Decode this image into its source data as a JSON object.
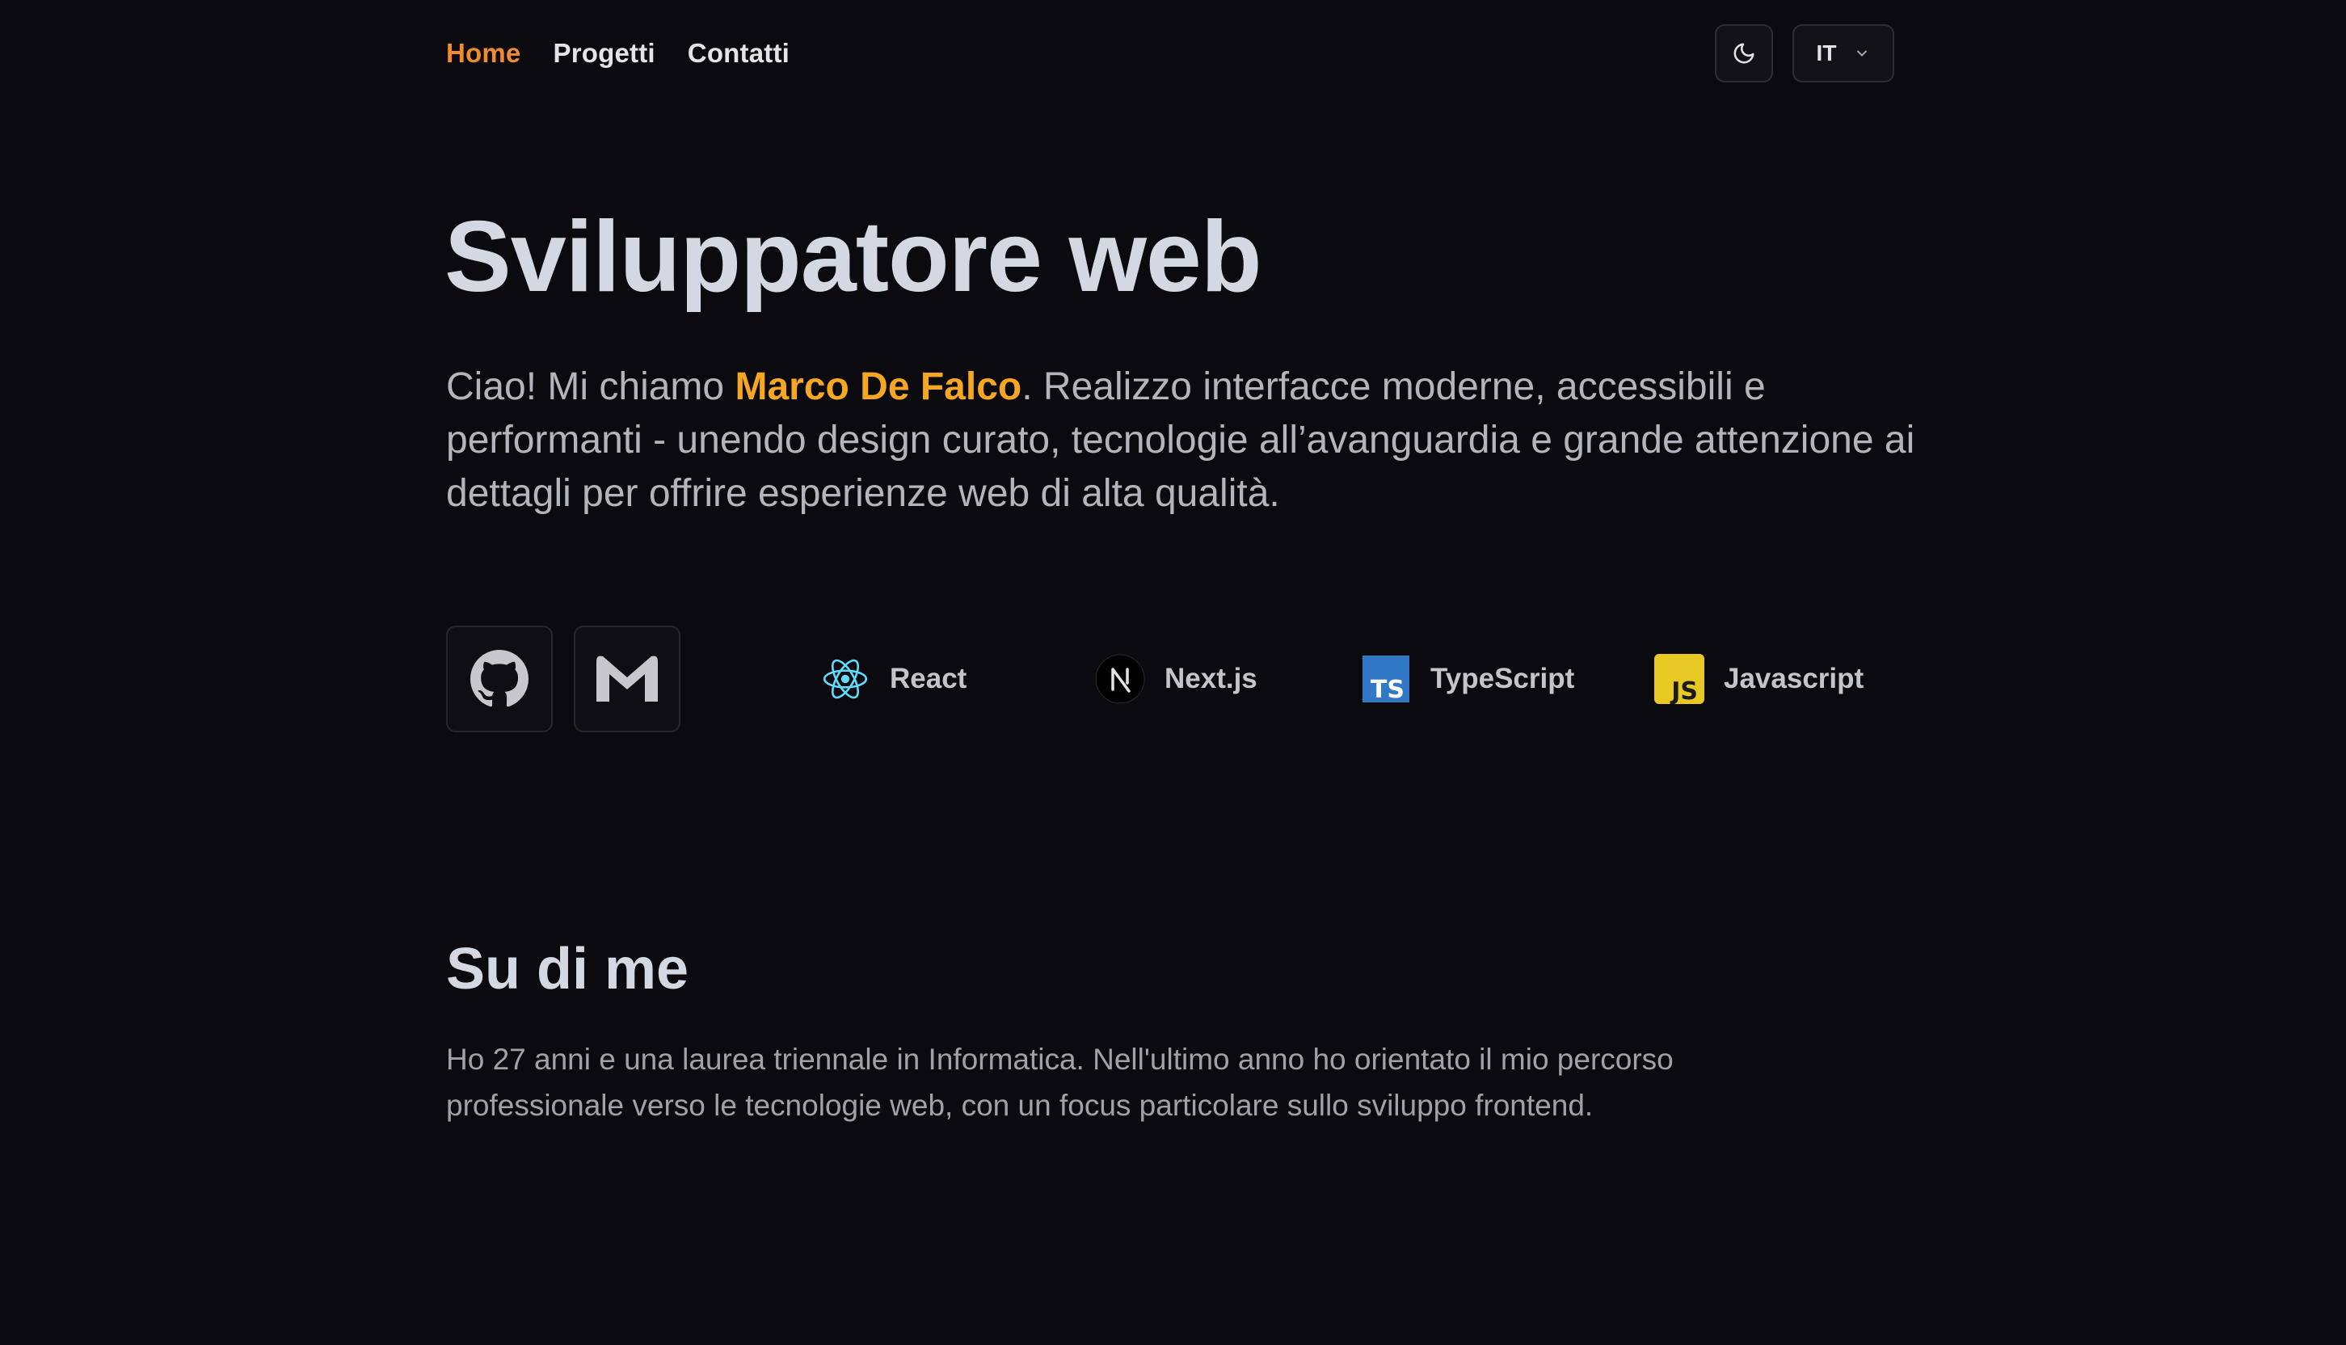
{
  "nav": {
    "items": [
      {
        "label": "Home",
        "active": true
      },
      {
        "label": "Progetti",
        "active": false
      },
      {
        "label": "Contatti",
        "active": false
      }
    ]
  },
  "controls": {
    "theme_icon": "moon-icon",
    "language": "IT",
    "language_icon": "chevron-down-icon"
  },
  "hero": {
    "title": "Sviluppatore web",
    "intro_before": "Ciao! Mi chiamo ",
    "name": "Marco De Falco",
    "intro_after": ". Realizzo interfacce moderne, accessibili e performanti - unendo design curato, tecnologie all’avanguardia e grande attenzione ai dettagli per offrire esperienze web di alta qualità."
  },
  "social": [
    {
      "icon": "github-icon"
    },
    {
      "icon": "gmail-icon"
    }
  ],
  "tech": [
    {
      "label": "React",
      "icon": "react-icon"
    },
    {
      "label": "Next.js",
      "icon": "nextjs-icon"
    },
    {
      "label": "TypeScript",
      "icon": "typescript-icon"
    },
    {
      "label": "Javascript",
      "icon": "javascript-icon"
    }
  ],
  "about": {
    "title": "Su di me",
    "text": "Ho 27 anni e una laurea triennale in Informatica. Nell'ultimo anno ho orientato il mio percorso professionale verso le tecnologie web, con un focus particolare sullo sviluppo frontend."
  },
  "colors": {
    "background": "#0b0b0f",
    "accent": "#f28a2e",
    "highlight": "#f5a623"
  }
}
